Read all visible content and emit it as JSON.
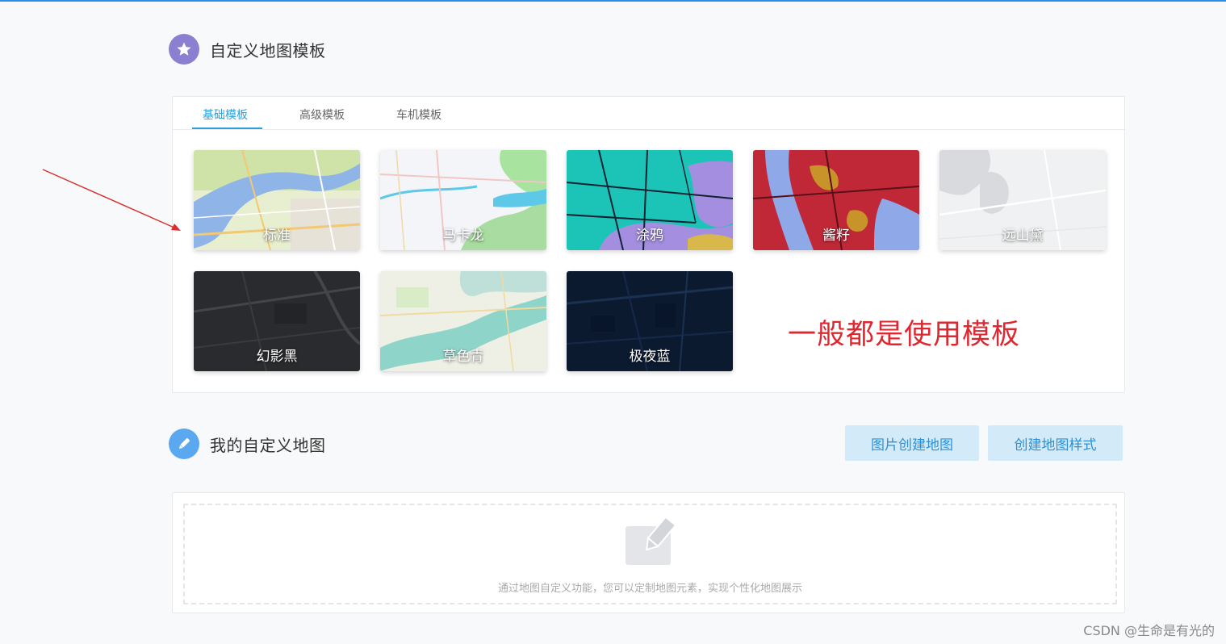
{
  "section_templates": {
    "title": "自定义地图模板",
    "icon": "star-icon"
  },
  "tabs": [
    {
      "label": "基础模板",
      "active": true
    },
    {
      "label": "高级模板",
      "active": false
    },
    {
      "label": "车机模板",
      "active": false
    }
  ],
  "templates": [
    {
      "label": "标准"
    },
    {
      "label": "马卡龙"
    },
    {
      "label": "涂鸦"
    },
    {
      "label": "酱籽"
    },
    {
      "label": "远山黛"
    },
    {
      "label": "幻影黑"
    },
    {
      "label": "草色青"
    },
    {
      "label": "极夜蓝"
    }
  ],
  "annotation": {
    "text": "一般都是使用模板",
    "color": "#e0262f"
  },
  "section_custom": {
    "title": "我的自定义地图",
    "icon": "edit-pen-icon"
  },
  "buttons": {
    "image_create": "图片创建地图",
    "create_style": "创建地图样式"
  },
  "empty_state": {
    "icon": "edit-map-icon",
    "text": "通过地图自定义功能，您可以定制地图元素，实现个性化地图展示"
  },
  "watermark": "CSDN @生命是有光的",
  "colors": {
    "accent": "#2e9fd8",
    "button_bg": "#d3ebf8",
    "star_circle": "#8a7fd0",
    "pen_circle": "#5aa8ef"
  }
}
